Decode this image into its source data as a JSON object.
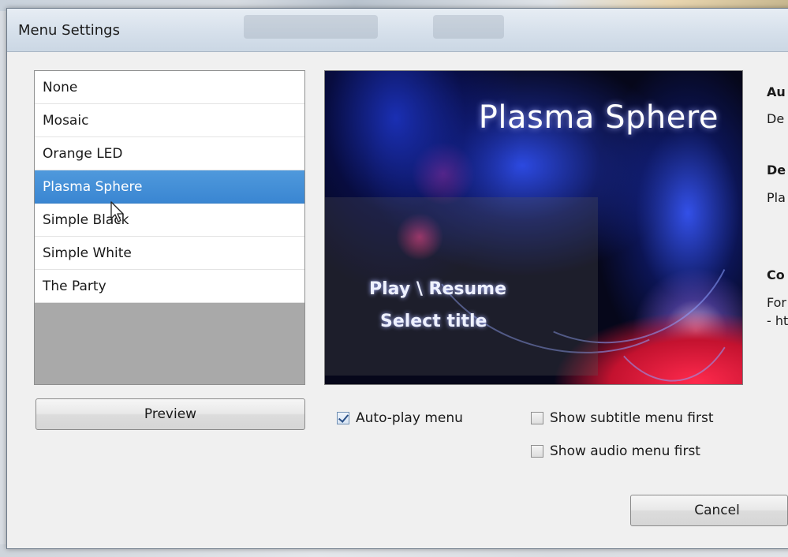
{
  "window": {
    "title": "Menu Settings"
  },
  "menu_styles": {
    "items": [
      {
        "label": "None"
      },
      {
        "label": "Mosaic"
      },
      {
        "label": "Orange LED"
      },
      {
        "label": "Plasma Sphere"
      },
      {
        "label": "Simple Black"
      },
      {
        "label": "Simple White"
      },
      {
        "label": "The Party"
      }
    ],
    "selected": "Plasma Sphere"
  },
  "preview_pane": {
    "title": "Plasma Sphere",
    "options": [
      "Play \\ Resume",
      "Select title"
    ]
  },
  "info": {
    "line1": "Au",
    "line2": "De",
    "line3": "De",
    "line4": "Pla",
    "line5": "Co",
    "line6": "For",
    "line7": "- ht"
  },
  "buttons": {
    "preview": "Preview",
    "cancel": "Cancel"
  },
  "checkboxes": {
    "autoplay": {
      "label": "Auto-play menu",
      "checked": true
    },
    "subtitle_first": {
      "label": "Show subtitle menu first",
      "checked": false
    },
    "audio_first": {
      "label": "Show audio menu first",
      "checked": false
    }
  }
}
